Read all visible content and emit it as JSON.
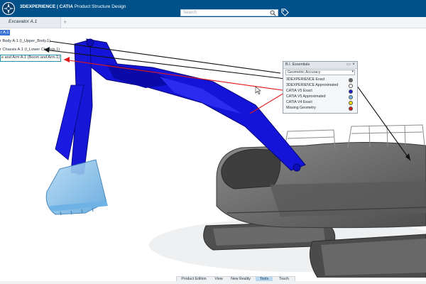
{
  "app": {
    "brand": "3DEXPERIENCE | CATIA",
    "title": "Product Structure Design"
  },
  "search": {
    "placeholder": "Search"
  },
  "tabs": [
    {
      "label": "Excavator A.1"
    }
  ],
  "tree": {
    "items": [
      {
        "label": "r A.1"
      },
      {
        "label": "r Body A.1 (I_Upper_Body.1)"
      },
      {
        "label": "r Chassis A.1 (I_Lower Chassis.1)"
      },
      {
        "label": "e and Arm A.1 (Boom and Arm.1)"
      }
    ]
  },
  "panel": {
    "title": "B.I. Essentials",
    "selected_option": "Geometric Accuracy",
    "legend": [
      {
        "label": "3DEXPERIENCE Exact",
        "color": "#6b6b6b"
      },
      {
        "label": "3DEXPERIENCE Approximated",
        "color": "#ffffff"
      },
      {
        "label": "CATIA V5 Exact",
        "color": "#1a1ad8"
      },
      {
        "label": "CATIA V5 Approximated",
        "color": "#6fb3e6"
      },
      {
        "label": "CATIA V4 Exact",
        "color": "#f2e200"
      },
      {
        "label": "Missing Geometry",
        "color": "#d81a1a"
      }
    ]
  },
  "bottom_tabs": [
    {
      "label": "Product Edition",
      "active": false
    },
    {
      "label": "View",
      "active": false
    },
    {
      "label": "New Reality",
      "active": false
    },
    {
      "label": "Tools",
      "active": true
    },
    {
      "label": "Touch",
      "active": false
    }
  ],
  "colors": {
    "header": "#00518a",
    "boom_blue": "#1a1ad8",
    "bucket_light_blue": "#8ec5ee",
    "body_gray": "#6e6e6e"
  }
}
